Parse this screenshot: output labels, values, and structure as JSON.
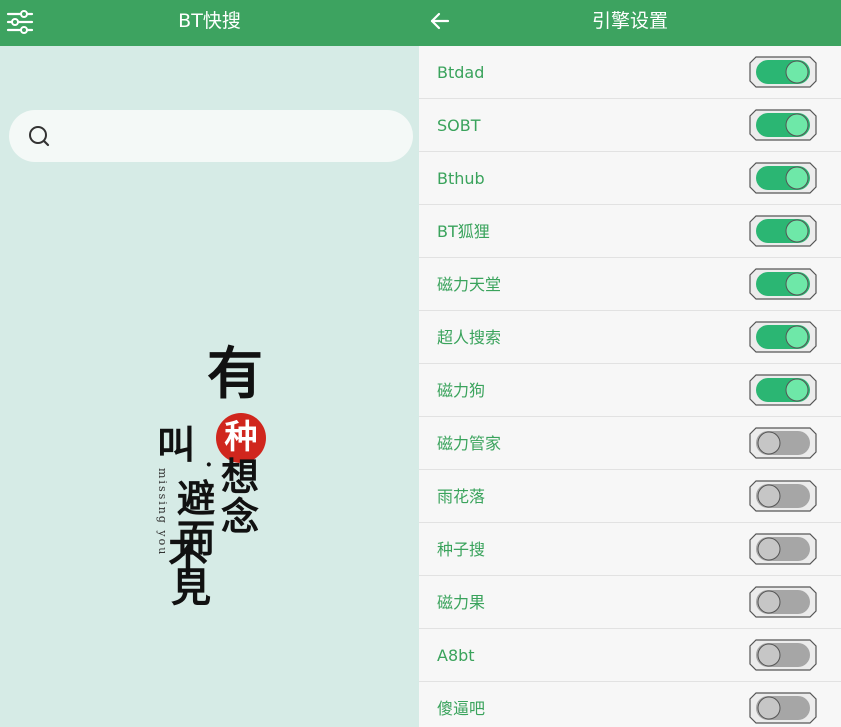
{
  "left_panel": {
    "title": "BT快搜",
    "header_icon": "filter-sliders-icon",
    "search": {
      "icon": "search-icon",
      "value": "",
      "placeholder": ""
    },
    "artwork": {
      "chars": {
        "you": "有",
        "zhong": "种",
        "jiao": "叫",
        "dot": "·",
        "xiang": "想",
        "nian": "念",
        "bi": "避",
        "er": "而",
        "bu": "不",
        "jian": "見"
      },
      "vertical_text": "missing you",
      "seal_color": "#d0261d"
    }
  },
  "right_panel": {
    "title": "引擎设置",
    "back_icon": "arrow-left-icon",
    "engines": [
      {
        "label": "Btdad",
        "enabled": true
      },
      {
        "label": "SOBT",
        "enabled": true
      },
      {
        "label": "Bthub",
        "enabled": true
      },
      {
        "label": "BT狐狸",
        "enabled": true
      },
      {
        "label": "磁力天堂",
        "enabled": true
      },
      {
        "label": "超人搜索",
        "enabled": true
      },
      {
        "label": "磁力狗",
        "enabled": true
      },
      {
        "label": "磁力管家",
        "enabled": false
      },
      {
        "label": "雨花落",
        "enabled": false
      },
      {
        "label": "种子搜",
        "enabled": false
      },
      {
        "label": "磁力果",
        "enabled": false
      },
      {
        "label": "A8bt",
        "enabled": false
      },
      {
        "label": "傻逼吧",
        "enabled": false
      }
    ]
  },
  "colors": {
    "toolbar": "#3da360",
    "accent_text": "#3aa35c",
    "toggle_on_track": "#2bb673",
    "toggle_on_thumb": "#6ee8a8",
    "toggle_off_track": "#a6a6a6",
    "toggle_off_thumb": "#c6c6c6",
    "left_background": "#d6ebe6"
  }
}
